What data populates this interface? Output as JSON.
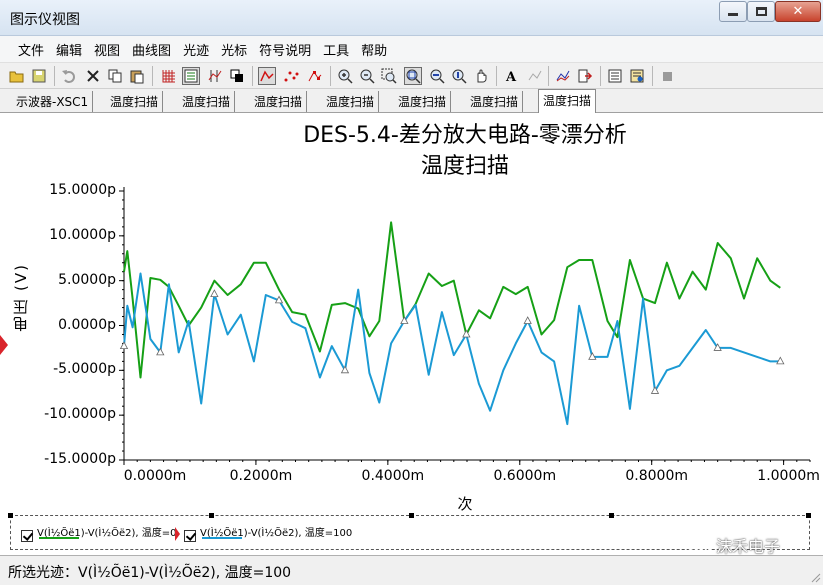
{
  "window": {
    "title": "图示仪视图",
    "minimize": "minimize",
    "maximize": "maximize",
    "close": "close"
  },
  "menu": [
    "文件",
    "编辑",
    "视图",
    "曲线图",
    "光迹",
    "光标",
    "符号说明",
    "工具",
    "帮助"
  ],
  "tabs": [
    "示波器-XSC1",
    "温度扫描",
    "温度扫描",
    "温度扫描",
    "温度扫描",
    "温度扫描",
    "温度扫描",
    "温度扫描"
  ],
  "active_tab_index": 7,
  "toolbar_icons": [
    "open-folder-icon",
    "save-icon",
    "undo-icon",
    "delete-icon",
    "copy-icon",
    "paste-icon",
    "grid-icon",
    "legend-icon",
    "cursor-icon",
    "overlay-icon",
    "trace-line-icon",
    "dots-icon",
    "markers-icon",
    "zoom-in-icon",
    "zoom-out-icon",
    "zoom-full-icon",
    "zoom-area-icon",
    "zoom-x-icon",
    "zoom-y-icon",
    "pan-icon",
    "text-icon",
    "label-icon",
    "graph-icon",
    "export-icon",
    "print-icon",
    "properties-icon",
    "stop-icon"
  ],
  "chart_data": {
    "type": "line",
    "title": "DES-5.4-差分放大电路-零漂分析",
    "subtitle": "温度扫描",
    "xlabel": "次",
    "ylabel": "电压 (V)",
    "xlim": [
      0,
      1.04
    ],
    "ylim": [
      -15,
      15
    ],
    "y_unit": "p",
    "x_unit": "m",
    "x_tick_values": [
      0,
      0.2,
      0.4,
      0.6,
      0.8,
      1.0
    ],
    "x_tick_labels": [
      "0.0000m",
      "0.2000m",
      "0.4000m",
      "0.6000m",
      "0.8000m",
      "1.0000m"
    ],
    "y_tick_values": [
      15,
      10,
      5,
      0,
      -5,
      -10,
      -15
    ],
    "y_tick_labels": [
      "15.0000p",
      "10.0000p",
      "5.0000p",
      "0.0000p",
      "-5.0000p",
      "-10.0000p",
      "-15.0000p"
    ],
    "grid": false,
    "series": [
      {
        "name": "V(Ì½Õë1)-V(Ì½Õë2), 温度=0",
        "color": "#16a016",
        "marker": "none",
        "points": [
          [
            0.0,
            6.0
          ],
          [
            0.005,
            8.3
          ],
          [
            0.013,
            3.0
          ],
          [
            0.025,
            -5.8
          ],
          [
            0.04,
            5.3
          ],
          [
            0.055,
            5.1
          ],
          [
            0.068,
            4.3
          ],
          [
            0.083,
            2.2
          ],
          [
            0.098,
            0.0
          ],
          [
            0.117,
            2.0
          ],
          [
            0.137,
            5.0
          ],
          [
            0.157,
            3.4
          ],
          [
            0.177,
            4.6
          ],
          [
            0.197,
            7.0
          ],
          [
            0.215,
            7.0
          ],
          [
            0.235,
            4.0
          ],
          [
            0.255,
            1.5
          ],
          [
            0.275,
            1.2
          ],
          [
            0.297,
            -2.9
          ],
          [
            0.315,
            2.3
          ],
          [
            0.335,
            2.5
          ],
          [
            0.355,
            1.9
          ],
          [
            0.372,
            -1.2
          ],
          [
            0.387,
            0.5
          ],
          [
            0.405,
            11.5
          ],
          [
            0.425,
            0.5
          ],
          [
            0.442,
            2.4
          ],
          [
            0.462,
            5.8
          ],
          [
            0.482,
            4.4
          ],
          [
            0.5,
            5.0
          ],
          [
            0.519,
            -1.0
          ],
          [
            0.538,
            1.7
          ],
          [
            0.555,
            0.8
          ],
          [
            0.575,
            4.3
          ],
          [
            0.594,
            3.5
          ],
          [
            0.612,
            4.3
          ],
          [
            0.633,
            -1.0
          ],
          [
            0.652,
            0.6
          ],
          [
            0.672,
            6.5
          ],
          [
            0.69,
            7.3
          ],
          [
            0.71,
            7.3
          ],
          [
            0.733,
            0.5
          ],
          [
            0.748,
            -1.3
          ],
          [
            0.767,
            7.3
          ],
          [
            0.787,
            3.0
          ],
          [
            0.805,
            2.5
          ],
          [
            0.823,
            7.0
          ],
          [
            0.842,
            3.0
          ],
          [
            0.862,
            6.0
          ],
          [
            0.882,
            4.0
          ],
          [
            0.9,
            9.2
          ],
          [
            0.92,
            7.5
          ],
          [
            0.94,
            3.0
          ],
          [
            0.96,
            7.5
          ],
          [
            0.98,
            5.0
          ],
          [
            0.995,
            4.2
          ]
        ]
      },
      {
        "name": "V(Ì½Õë1)-V(Ì½Õë2), 温度=100",
        "color": "#1b9ad4",
        "marker": "triangle",
        "points": [
          [
            0.0,
            -2.3
          ],
          [
            0.005,
            2.2
          ],
          [
            0.013,
            -0.2
          ],
          [
            0.025,
            5.8
          ],
          [
            0.04,
            -1.5
          ],
          [
            0.055,
            -3.0
          ],
          [
            0.068,
            4.6
          ],
          [
            0.083,
            -3.0
          ],
          [
            0.098,
            0.5
          ],
          [
            0.117,
            -8.7
          ],
          [
            0.137,
            3.5
          ],
          [
            0.157,
            -1.0
          ],
          [
            0.177,
            1.2
          ],
          [
            0.197,
            -4.0
          ],
          [
            0.215,
            3.4
          ],
          [
            0.235,
            2.8
          ],
          [
            0.255,
            0.4
          ],
          [
            0.275,
            -0.3
          ],
          [
            0.297,
            -5.8
          ],
          [
            0.315,
            -2.3
          ],
          [
            0.335,
            -5.0
          ],
          [
            0.355,
            4.0
          ],
          [
            0.372,
            -5.3
          ],
          [
            0.387,
            -8.6
          ],
          [
            0.405,
            -2.0
          ],
          [
            0.425,
            0.5
          ],
          [
            0.442,
            2.3
          ],
          [
            0.462,
            -5.5
          ],
          [
            0.482,
            1.5
          ],
          [
            0.5,
            -3.3
          ],
          [
            0.519,
            -1.0
          ],
          [
            0.538,
            -6.5
          ],
          [
            0.555,
            -9.5
          ],
          [
            0.575,
            -5.0
          ],
          [
            0.594,
            -2.0
          ],
          [
            0.612,
            0.5
          ],
          [
            0.633,
            -3.0
          ],
          [
            0.652,
            -4.0
          ],
          [
            0.672,
            -11.0
          ],
          [
            0.69,
            2.2
          ],
          [
            0.71,
            -3.5
          ],
          [
            0.733,
            -3.5
          ],
          [
            0.748,
            0.5
          ],
          [
            0.767,
            -9.3
          ],
          [
            0.787,
            3.0
          ],
          [
            0.805,
            -7.3
          ],
          [
            0.823,
            -5.0
          ],
          [
            0.842,
            -4.5
          ],
          [
            0.862,
            -2.5
          ],
          [
            0.882,
            -0.5
          ],
          [
            0.9,
            -2.5
          ],
          [
            0.92,
            -2.5
          ],
          [
            0.94,
            -3.0
          ],
          [
            0.96,
            -3.5
          ],
          [
            0.98,
            -4.0
          ],
          [
            0.995,
            -4.0
          ]
        ]
      }
    ]
  },
  "legend": {
    "items": [
      {
        "label": "V(Ì½Õë1)-V(Ì½Õë2), 温度=0",
        "color": "#16a016"
      },
      {
        "label": "V(Ì½Õë1)-V(Ì½Õë2), 温度=100",
        "color": "#1b9ad4"
      }
    ]
  },
  "status": {
    "text": "所选光迹：V(Ì½Õë1)-V(Ì½Õë2), 温度=100"
  },
  "watermark": "沫禾电子"
}
